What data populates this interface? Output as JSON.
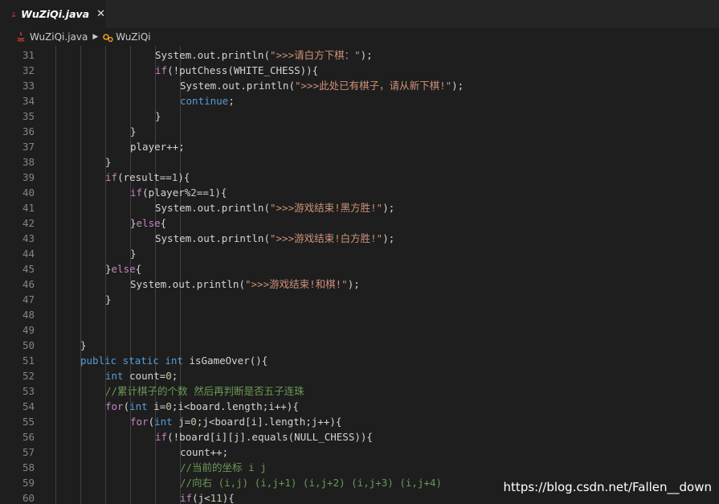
{
  "tab": {
    "title": "WuZiQi.java",
    "close": "✕"
  },
  "breadcrumb": {
    "file": "WuZiQi.java",
    "class": "WuZiQi"
  },
  "colors": {
    "keyword": "#569cd6",
    "control": "#c586c0",
    "string": "#ce9178",
    "number": "#b5cea8",
    "comment": "#6a9955",
    "plain": "#d4d4d4",
    "line_number": "#858585",
    "background": "#1e1e1e"
  },
  "lines": [
    {
      "n": "31",
      "indent": 3,
      "tokens": [
        [
          "p",
          "System.out.println("
        ],
        [
          "s",
          "\">>>请白方下棋：\""
        ],
        [
          "p",
          ");"
        ]
      ]
    },
    {
      "n": "32",
      "indent": 3,
      "tokens": [
        [
          "k",
          "if"
        ],
        [
          "p",
          "(!putChess(WHITE_CHESS)){"
        ]
      ]
    },
    {
      "n": "33",
      "indent": 4,
      "tokens": [
        [
          "p",
          "System.out.println("
        ],
        [
          "s",
          "\">>>此处已有棋子，请从新下棋!\""
        ],
        [
          "p",
          ");"
        ]
      ]
    },
    {
      "n": "34",
      "indent": 4,
      "tokens": [
        [
          "b",
          "continue"
        ],
        [
          "p",
          ";"
        ]
      ]
    },
    {
      "n": "35",
      "indent": 3,
      "tokens": [
        [
          "p",
          "}"
        ]
      ]
    },
    {
      "n": "36",
      "indent": 2,
      "tokens": [
        [
          "p",
          "}"
        ]
      ]
    },
    {
      "n": "37",
      "indent": 2,
      "tokens": [
        [
          "p",
          "player++;"
        ]
      ]
    },
    {
      "n": "38",
      "indent": 1,
      "tokens": [
        [
          "p",
          "}"
        ]
      ]
    },
    {
      "n": "39",
      "indent": 1,
      "tokens": [
        [
          "k",
          "if"
        ],
        [
          "p",
          "(result=="
        ],
        [
          "d",
          "1"
        ],
        [
          "p",
          "){"
        ]
      ]
    },
    {
      "n": "40",
      "indent": 2,
      "tokens": [
        [
          "k",
          "if"
        ],
        [
          "p",
          "(player%"
        ],
        [
          "d",
          "2"
        ],
        [
          "p",
          "=="
        ],
        [
          "d",
          "1"
        ],
        [
          "p",
          "){"
        ]
      ]
    },
    {
      "n": "41",
      "indent": 3,
      "tokens": [
        [
          "p",
          "System.out.println("
        ],
        [
          "s",
          "\">>>游戏结束!黑方胜!\""
        ],
        [
          "p",
          ");"
        ]
      ]
    },
    {
      "n": "42",
      "indent": 2,
      "tokens": [
        [
          "p",
          "}"
        ],
        [
          "k",
          "else"
        ],
        [
          "p",
          "{"
        ]
      ]
    },
    {
      "n": "43",
      "indent": 3,
      "tokens": [
        [
          "p",
          "System.out.println("
        ],
        [
          "s",
          "\">>>游戏结束!白方胜!\""
        ],
        [
          "p",
          ");"
        ]
      ]
    },
    {
      "n": "44",
      "indent": 2,
      "tokens": [
        [
          "p",
          "}"
        ]
      ]
    },
    {
      "n": "45",
      "indent": 1,
      "tokens": [
        [
          "p",
          "}"
        ],
        [
          "k",
          "else"
        ],
        [
          "p",
          "{"
        ]
      ]
    },
    {
      "n": "46",
      "indent": 2,
      "tokens": [
        [
          "p",
          "System.out.println("
        ],
        [
          "s",
          "\">>>游戏结束!和棋!\""
        ],
        [
          "p",
          ");"
        ]
      ]
    },
    {
      "n": "47",
      "indent": 1,
      "tokens": [
        [
          "p",
          "}"
        ]
      ]
    },
    {
      "n": "48",
      "indent": 0,
      "tokens": []
    },
    {
      "n": "49",
      "indent": 0,
      "tokens": []
    },
    {
      "n": "50",
      "indent": 0,
      "tokens": [
        [
          "p",
          "}"
        ]
      ]
    },
    {
      "n": "51",
      "indent": 0,
      "tokens": [
        [
          "b",
          "public static int "
        ],
        [
          "p",
          "isGameOver(){"
        ]
      ]
    },
    {
      "n": "52",
      "indent": 1,
      "tokens": [
        [
          "b",
          "int "
        ],
        [
          "p",
          "count="
        ],
        [
          "d",
          "0"
        ],
        [
          "p",
          ";"
        ]
      ]
    },
    {
      "n": "53",
      "indent": 1,
      "tokens": [
        [
          "c",
          "//累计棋子的个数 然后再判断是否五子连珠"
        ]
      ]
    },
    {
      "n": "54",
      "indent": 1,
      "tokens": [
        [
          "k",
          "for"
        ],
        [
          "p",
          "("
        ],
        [
          "b",
          "int "
        ],
        [
          "p",
          "i="
        ],
        [
          "d",
          "0"
        ],
        [
          "p",
          ";i<board.length;i++){"
        ]
      ]
    },
    {
      "n": "55",
      "indent": 2,
      "tokens": [
        [
          "k",
          "for"
        ],
        [
          "p",
          "("
        ],
        [
          "b",
          "int "
        ],
        [
          "p",
          "j="
        ],
        [
          "d",
          "0"
        ],
        [
          "p",
          ";j<board[i].length;j++){"
        ]
      ]
    },
    {
      "n": "56",
      "indent": 3,
      "tokens": [
        [
          "k",
          "if"
        ],
        [
          "p",
          "(!board[i][j].equals(NULL_CHESS)){"
        ]
      ]
    },
    {
      "n": "57",
      "indent": 4,
      "tokens": [
        [
          "p",
          "count++;"
        ]
      ]
    },
    {
      "n": "58",
      "indent": 4,
      "tokens": [
        [
          "c",
          "//当前的坐标 i j"
        ]
      ]
    },
    {
      "n": "59",
      "indent": 4,
      "tokens": [
        [
          "c",
          "//向右 (i,j) (i,j+1) (i,j+2) (i,j+3) (i,j+4)"
        ]
      ]
    },
    {
      "n": "60",
      "indent": 4,
      "tokens": [
        [
          "k",
          "if"
        ],
        [
          "p",
          "(j<"
        ],
        [
          "d",
          "11"
        ],
        [
          "p",
          "){"
        ]
      ]
    }
  ],
  "watermark": "https://blog.csdn.net/Fallen__down"
}
